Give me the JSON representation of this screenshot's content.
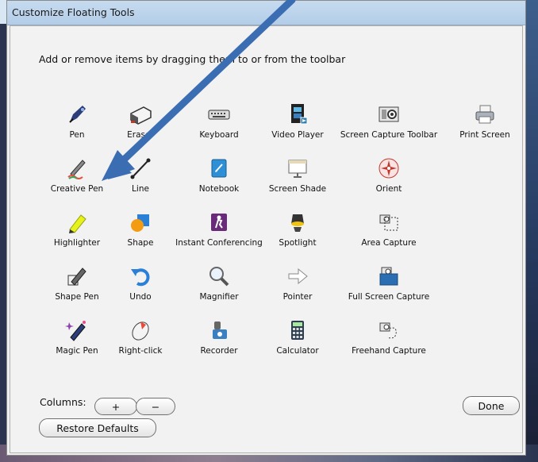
{
  "window": {
    "title": "Customize Floating Tools"
  },
  "instructions": "Add or remove items by dragging them to or from the toolbar",
  "tools": [
    {
      "label": "Pen",
      "icon": "pen-icon"
    },
    {
      "label": "Eraser",
      "icon": "eraser-icon"
    },
    {
      "label": "Keyboard",
      "icon": "keyboard-icon"
    },
    {
      "label": "Video Player",
      "icon": "video-player-icon"
    },
    {
      "label": "Screen Capture Toolbar",
      "icon": "camera-icon"
    },
    {
      "label": "Print Screen",
      "icon": "printer-icon"
    },
    {
      "label": "Creative Pen",
      "icon": "creative-pen-icon"
    },
    {
      "label": "Line",
      "icon": "line-icon"
    },
    {
      "label": "Notebook",
      "icon": "notebook-icon"
    },
    {
      "label": "Screen Shade",
      "icon": "screen-shade-icon"
    },
    {
      "label": "Orient",
      "icon": "orient-icon"
    },
    {
      "label": "Highlighter",
      "icon": "highlighter-icon"
    },
    {
      "label": "Shape",
      "icon": "shape-icon"
    },
    {
      "label": "Instant Conferencing",
      "icon": "conferencing-icon"
    },
    {
      "label": "Spotlight",
      "icon": "spotlight-icon"
    },
    {
      "label": "Area Capture",
      "icon": "area-capture-icon"
    },
    {
      "label": "Shape Pen",
      "icon": "shape-pen-icon"
    },
    {
      "label": "Undo",
      "icon": "undo-icon"
    },
    {
      "label": "Magnifier",
      "icon": "magnifier-icon"
    },
    {
      "label": "Pointer",
      "icon": "pointer-icon"
    },
    {
      "label": "Full Screen Capture",
      "icon": "full-screen-capture-icon"
    },
    {
      "label": "Magic Pen",
      "icon": "magic-pen-icon"
    },
    {
      "label": "Right-click",
      "icon": "mouse-icon"
    },
    {
      "label": "Recorder",
      "icon": "recorder-icon"
    },
    {
      "label": "Calculator",
      "icon": "calculator-icon"
    },
    {
      "label": "Freehand Capture",
      "icon": "freehand-capture-icon"
    }
  ],
  "columns": {
    "label": "Columns:",
    "plus": "+",
    "minus": "−"
  },
  "buttons": {
    "done": "Done",
    "restore": "Restore Defaults"
  },
  "annotation": {
    "arrow_color": "#3b6db3",
    "target": "Creative Pen"
  }
}
